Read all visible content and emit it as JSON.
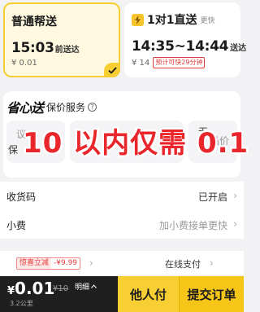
{
  "service_options": {
    "standard": {
      "title": "普通帮送",
      "time": "15:03",
      "time_suffix": "前送达",
      "price": "¥ 0.01",
      "selected": true
    },
    "direct": {
      "title": "1对1直送",
      "tag": "更快",
      "time": "14:35~14:44",
      "time_suffix": "送达",
      "price": "¥ 14",
      "saving_badge": "预计可快29分钟"
    }
  },
  "insurance": {
    "brand": "省心送",
    "title": "保价服务",
    "option_left_visible": "保",
    "option_left_faded": "议",
    "option_right_visible": "无",
    "option_right_faded": "品价"
  },
  "overlay_caption": "10 以内仅需 0.1",
  "rows": {
    "pickup_code": {
      "label": "收货码",
      "value": "已开启"
    },
    "tip": {
      "label": "小费",
      "hint": "加小费接单更快"
    }
  },
  "payment": {
    "discount_tag": "惊喜立减",
    "discount_amount": "-¥9.99",
    "method": "在线支付"
  },
  "bottom_bar": {
    "currency": "¥",
    "total": "0.01",
    "original": "¥10",
    "detail": "明细",
    "distance": "3.2公里",
    "pay_by_other": "他人付",
    "submit": "提交订单"
  },
  "colors": {
    "brand_yellow": "#f7cf33",
    "selected_bg": "#fff9df",
    "discount_red": "#e23b3b",
    "overlay_red": "#e8262b",
    "bar_dark": "#1f1f1f"
  }
}
